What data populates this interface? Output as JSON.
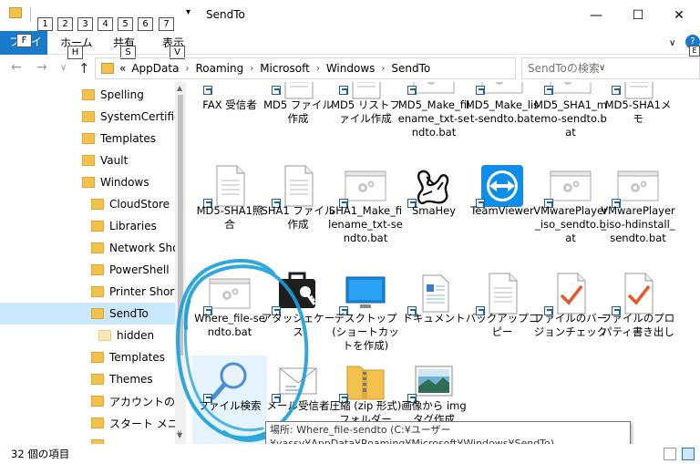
{
  "window": {
    "title": "SendTo",
    "minimize_glyph": "—",
    "maximize_glyph": "☐",
    "close_glyph": "✕"
  },
  "quick_access_keys": [
    "1",
    "2",
    "3",
    "4",
    "5",
    "6",
    "7"
  ],
  "ribbon": {
    "file_tab": "ファイル",
    "file_key": "F",
    "tabs": [
      {
        "label": "ホーム",
        "key": "H"
      },
      {
        "label": "共有",
        "key": "S"
      },
      {
        "label": "表示",
        "key": "V"
      }
    ],
    "help_key": "E"
  },
  "address": {
    "prefix": "«",
    "crumbs": [
      "AppData",
      "Roaming",
      "Microsoft",
      "Windows",
      "SendTo"
    ],
    "search_placeholder": "SendToの検索"
  },
  "nav_pane": {
    "items": [
      {
        "label": "Spelling",
        "indent": 1
      },
      {
        "label": "SystemCertificat",
        "indent": 1
      },
      {
        "label": "Templates",
        "indent": 1
      },
      {
        "label": "Vault",
        "indent": 1
      },
      {
        "label": "Windows",
        "indent": 1
      },
      {
        "label": "CloudStore",
        "indent": 2
      },
      {
        "label": "Libraries",
        "indent": 2
      },
      {
        "label": "Network Short",
        "indent": 2
      },
      {
        "label": "PowerShell",
        "indent": 2
      },
      {
        "label": "Printer Shortcu",
        "indent": 2
      },
      {
        "label": "SendTo",
        "indent": 2,
        "selected": true
      },
      {
        "label": "hidden",
        "indent": 3
      },
      {
        "label": "Templates",
        "indent": 2
      },
      {
        "label": "Themes",
        "indent": 2
      },
      {
        "label": "アカウントの画像",
        "indent": 2
      },
      {
        "label": "スタート メニュー",
        "indent": 2
      },
      {
        "label": "",
        "indent": 2
      }
    ]
  },
  "files": [
    {
      "label": "FAX 受信者",
      "icon": "fax-icon"
    },
    {
      "label": "MD5 ファイル作成",
      "icon": "document-icon"
    },
    {
      "label": "MD5 リストファイル作成",
      "icon": "document-icon"
    },
    {
      "label": "MD5_Make_filename_txt-sendto.bat",
      "icon": "batch-file-icon"
    },
    {
      "label": "MD5_Make_list-sendto.bat",
      "icon": "batch-file-icon"
    },
    {
      "label": "MD5_SHA1_memo-sendto.bat",
      "icon": "batch-file-icon"
    },
    {
      "label": "MD5-SHA1メモ",
      "icon": "document-icon"
    },
    {
      "label": "MD5-SHA1照合",
      "icon": "document-icon"
    },
    {
      "label": "SHA1 ファイル作成",
      "icon": "document-icon"
    },
    {
      "label": "SHA1_Make_filename_txt-sendto.bat",
      "icon": "batch-file-icon"
    },
    {
      "label": "SmaHey",
      "icon": "smahey-icon"
    },
    {
      "label": "TeamViewer",
      "icon": "teamviewer-icon"
    },
    {
      "label": "VMwarePlayer_iso_sendto.bat",
      "icon": "batch-file-icon"
    },
    {
      "label": "VMwarePlayer_iso-hdinstall_sendto.bat",
      "icon": "batch-file-icon"
    },
    {
      "label": "Where_file-sendto.bat",
      "icon": "batch-file-icon"
    },
    {
      "label": "アタッシェケース",
      "icon": "attache-case-icon"
    },
    {
      "label": "デスクトップ (ショートカットを作成)",
      "icon": "desktop-icon"
    },
    {
      "label": "ドキュメント",
      "icon": "documents-icon"
    },
    {
      "label": "バックアップコピー",
      "icon": "document-icon"
    },
    {
      "label": "ファイルのバージョンチェック",
      "icon": "checkmark-document-icon"
    },
    {
      "label": "ファイルのプロパティ書き出し",
      "icon": "checkmark-document-icon"
    },
    {
      "label": "ファイル検索",
      "icon": "magnifier-icon"
    },
    {
      "label": "メール受信者",
      "icon": "mail-icon"
    },
    {
      "label": "圧縮 (zip 形式) フォルダー",
      "icon": "zip-folder-icon"
    },
    {
      "label": "画像から img タグ作成",
      "icon": "image-icon"
    }
  ],
  "tooltip": {
    "text": "場所: Where_file-sendto (C:¥ユーザー¥yassy¥AppData¥Roaming¥Microsoft¥Windows¥SendTo)"
  },
  "status": {
    "count": "32 個の項目"
  },
  "colors": {
    "accent": "#1979ca",
    "selection": "#cce8ff",
    "hover": "#e5f3ff",
    "folder": "#f2c14e",
    "annotation": "#1a9fd8"
  }
}
